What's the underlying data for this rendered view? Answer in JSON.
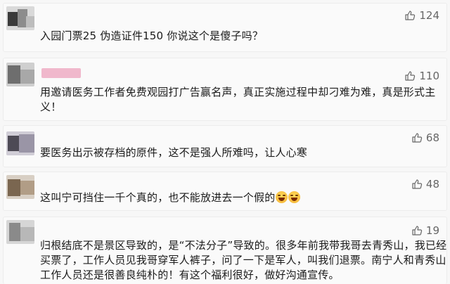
{
  "comments": [
    {
      "text_lines": [
        "入园门票25 伪造证件150 你说这个是傻子吗？"
      ],
      "likes": "124"
    },
    {
      "text_lines": [
        "用邀请医务工作者免费观园打广告赢名声，真正实施过程中却刁难为难，真是形式主",
        "义！"
      ],
      "likes": "110"
    },
    {
      "text_lines": [
        "要医务出示被存档的原件，这不是强人所难吗，让人心寒"
      ],
      "likes": "68"
    },
    {
      "text_lines": [
        "这叫宁可挡住一千个真的，也不能放进去一个假的"
      ],
      "likes": "48",
      "emojis": [
        "grin-sweat-emoji",
        "grin-sweat-emoji"
      ]
    },
    {
      "text_lines": [
        "归根结底不是景区导致的，是“不法分子”导致的。很多年前我带我哥去青秀山，我已经",
        "买票了，工作人员见我哥穿军人裤子，问了一下是军人，叫我们退票。南宁人和青秀山",
        "工作人员还是很善良纯朴的！有这个福利很好，做好沟通宣传。"
      ],
      "likes": "19"
    }
  ],
  "icons": {
    "like": "thumbs-up-icon"
  },
  "colors": {
    "background": "#f7f7f7",
    "card": "#fafafa",
    "text": "#1a1a1a",
    "like_count": "#666666"
  }
}
